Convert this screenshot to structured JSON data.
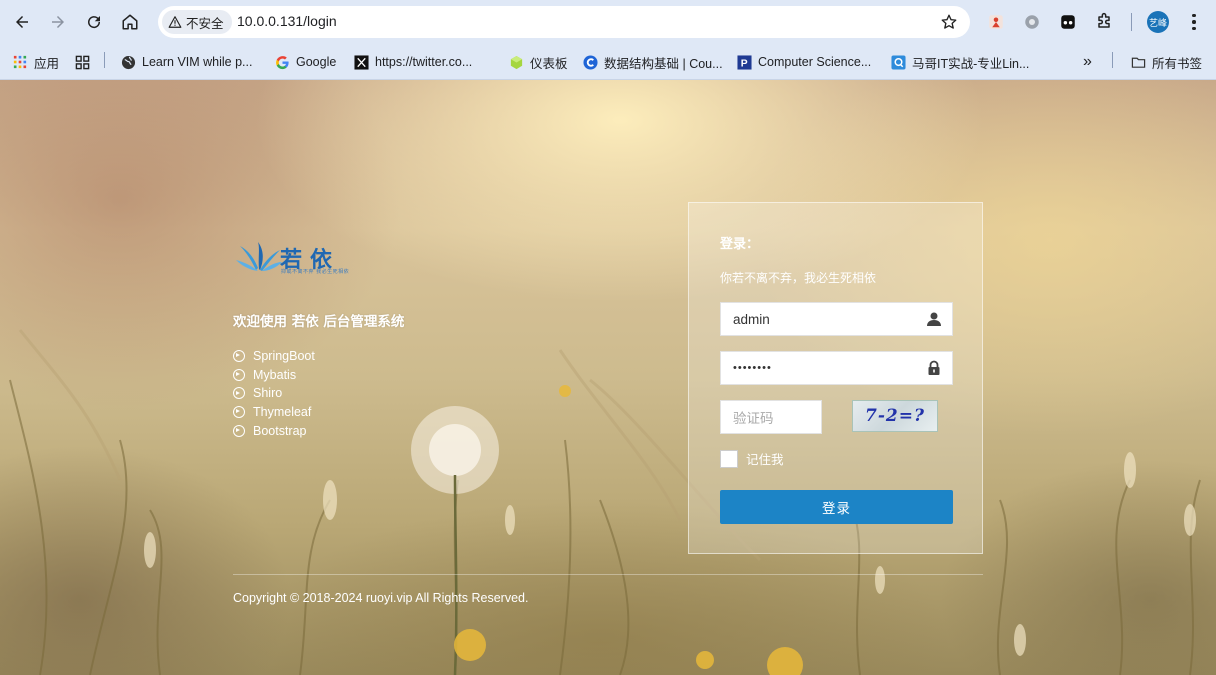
{
  "browser": {
    "security_label": "不安全",
    "url": "10.0.0.131/login",
    "profile_initials": "艺峰",
    "bookmarks": [
      {
        "label": "应用",
        "icon": "apps-icon"
      },
      {
        "label": "",
        "icon": "grid-icon"
      },
      {
        "label": "Learn VIM while p...",
        "icon": "globe-icon"
      },
      {
        "label": "Google",
        "icon": "google-icon"
      },
      {
        "label": "https://twitter.co...",
        "icon": "x-icon"
      },
      {
        "label": "仪表板",
        "icon": "cube-icon"
      },
      {
        "label": "数据结构基础 | Cou...",
        "icon": "c-icon"
      },
      {
        "label": "Computer Science...",
        "icon": "p-icon"
      },
      {
        "label": "马哥IT实战-专业Lin...",
        "icon": "q-icon"
      }
    ],
    "bookmarks_overflow": "»",
    "all_bookmarks": "所有书签"
  },
  "brand": {
    "name": "若依",
    "slogan": "抑或不离不弃 我必生死相依",
    "welcome": "欢迎使用 若依 后台管理系统"
  },
  "tech_stack": [
    "SpringBoot",
    "Mybatis",
    "Shiro",
    "Thymeleaf",
    "Bootstrap"
  ],
  "login": {
    "title": "登录：",
    "subtitle": "你若不离不弃，我必生死相依",
    "username": "admin",
    "password_masked": "••••••••",
    "captcha_placeholder": "验证码",
    "captcha_text": "7-2=?",
    "remember_label": "记住我",
    "submit_label": "登录"
  },
  "footer": {
    "copyright": "Copyright © 2018-2024 ruoyi.vip All Rights Reserved."
  },
  "colors": {
    "primary": "#1c84c6",
    "brand": "#1f68b2",
    "chrome": "#dfe8f6"
  }
}
